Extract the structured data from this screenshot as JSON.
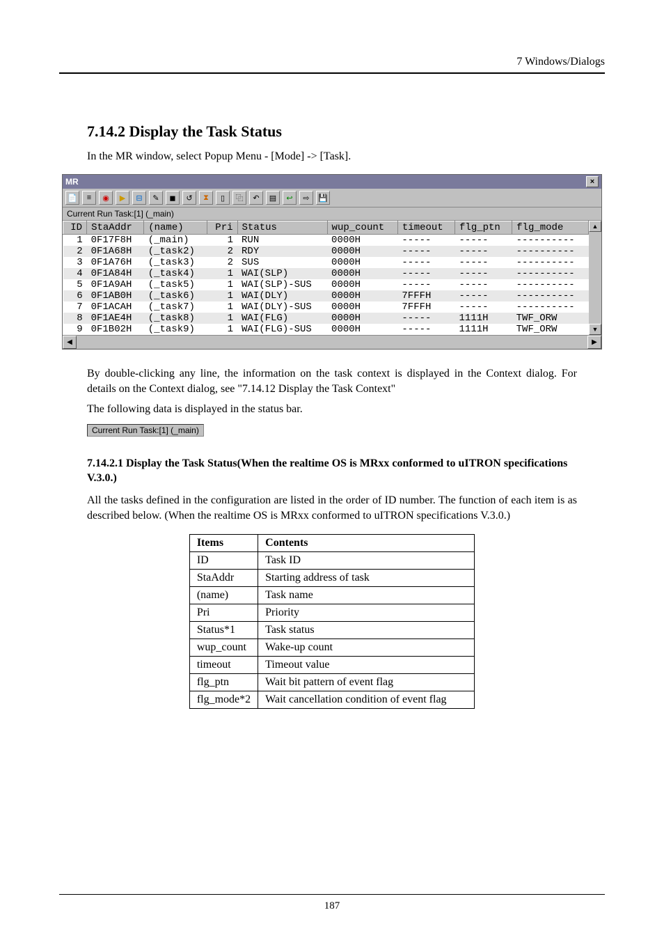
{
  "header": {
    "chapter": "7  Windows/Dialogs"
  },
  "section": {
    "number_title": "7.14.2 Display the Task Status",
    "intro": "In the MR window, select Popup Menu - [Mode] -> [Task]."
  },
  "mr": {
    "title": "MR",
    "close": "×",
    "status_text": "Current Run Task:[1] (_main)",
    "columns": [
      "ID",
      "StaAddr",
      "(name)",
      "Pri",
      "Status",
      "wup_count",
      "timeout",
      "flg_ptn",
      "flg_mode"
    ],
    "rows": [
      {
        "id": "1",
        "addr": "0F17F8H",
        "name": "(_main)",
        "pri": "1",
        "status": "RUN",
        "wup": "0000H",
        "timeout": "-----",
        "flg_ptn": "-----",
        "flg_mode": "----------"
      },
      {
        "id": "2",
        "addr": "0F1A68H",
        "name": "(_task2)",
        "pri": "2",
        "status": "RDY",
        "wup": "0000H",
        "timeout": "-----",
        "flg_ptn": "-----",
        "flg_mode": "----------"
      },
      {
        "id": "3",
        "addr": "0F1A76H",
        "name": "(_task3)",
        "pri": "2",
        "status": "SUS",
        "wup": "0000H",
        "timeout": "-----",
        "flg_ptn": "-----",
        "flg_mode": "----------"
      },
      {
        "id": "4",
        "addr": "0F1A84H",
        "name": "(_task4)",
        "pri": "1",
        "status": "WAI(SLP)",
        "wup": "0000H",
        "timeout": "-----",
        "flg_ptn": "-----",
        "flg_mode": "----------"
      },
      {
        "id": "5",
        "addr": "0F1A9AH",
        "name": "(_task5)",
        "pri": "1",
        "status": "WAI(SLP)-SUS",
        "wup": "0000H",
        "timeout": "-----",
        "flg_ptn": "-----",
        "flg_mode": "----------"
      },
      {
        "id": "6",
        "addr": "0F1AB0H",
        "name": "(_task6)",
        "pri": "1",
        "status": "WAI(DLY)",
        "wup": "0000H",
        "timeout": "7FFFH",
        "flg_ptn": "-----",
        "flg_mode": "----------"
      },
      {
        "id": "7",
        "addr": "0F1ACAH",
        "name": "(_task7)",
        "pri": "1",
        "status": "WAI(DLY)-SUS",
        "wup": "0000H",
        "timeout": "7FFFH",
        "flg_ptn": "-----",
        "flg_mode": "----------"
      },
      {
        "id": "8",
        "addr": "0F1AE4H",
        "name": "(_task8)",
        "pri": "1",
        "status": "WAI(FLG)",
        "wup": "0000H",
        "timeout": "-----",
        "flg_ptn": "1111H",
        "flg_mode": "TWF_ORW"
      },
      {
        "id": "9",
        "addr": "0F1B02H",
        "name": "(_task9)",
        "pri": "1",
        "status": "WAI(FLG)-SUS",
        "wup": "0000H",
        "timeout": "-----",
        "flg_ptn": "1111H",
        "flg_mode": "TWF_ORW"
      }
    ]
  },
  "para1": "By double-clicking any line, the information on the task context is displayed in the Context dialog. For details on the Context dialog, see \"7.14.12 Display the Task Context\"",
  "para2": "The following data is displayed in the status bar.",
  "status_bar_img": "Current Run Task:[1] (_main)",
  "subsection": {
    "title": "7.14.2.1 Display the Task Status(When the realtime OS is MRxx conformed to uITRON specifications V.3.0.)",
    "text": "All the tasks defined in the configuration are listed in the order of ID number. The function of each item is as described below. (When the realtime OS is MRxx conformed to uITRON specifications V.3.0.)"
  },
  "def_table": {
    "headers": [
      "Items",
      "Contents"
    ],
    "rows": [
      [
        "ID",
        "Task ID"
      ],
      [
        "StaAddr",
        "Starting address of task"
      ],
      [
        "(name)",
        "Task name"
      ],
      [
        "Pri",
        "Priority"
      ],
      [
        "Status*1",
        "Task status"
      ],
      [
        "wup_count",
        "Wake-up count"
      ],
      [
        "timeout",
        "Timeout value"
      ],
      [
        "flg_ptn",
        "Wait bit pattern of event flag"
      ],
      [
        "flg_mode*2",
        "Wait cancellation condition of event flag"
      ]
    ]
  },
  "footer": {
    "page": "187"
  },
  "toolbar_icons": [
    "page-icon",
    "list-icon",
    "record-red-icon",
    "play-icon",
    "meter-icon",
    "pencil-icon",
    "stop-icon",
    "rewind-icon",
    "hourglass-icon",
    "page2-icon",
    "copy-icon",
    "undo-icon",
    "doc-icon",
    "return-icon",
    "next-icon",
    "save-icon"
  ]
}
